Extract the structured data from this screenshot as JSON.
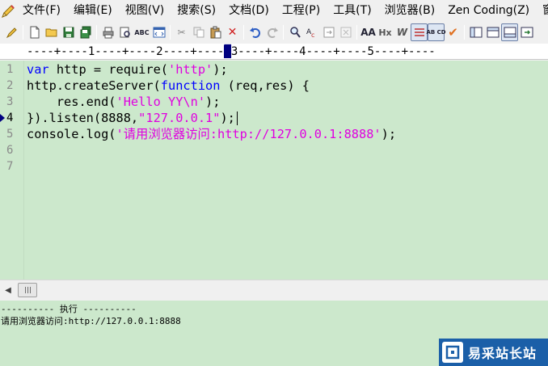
{
  "menubar": {
    "items": [
      "文件(F)",
      "编辑(E)",
      "视图(V)",
      "搜索(S)",
      "文档(D)",
      "工程(P)",
      "工具(T)",
      "浏览器(B)",
      "Zen Coding(Z)",
      "窗"
    ]
  },
  "toolbar": {
    "icons": [
      "pencil-icon",
      "new-file-icon",
      "open-folder-icon",
      "save-icon",
      "save-all-icon",
      "print-icon",
      "print-preview-icon",
      "spellcheck-icon",
      "browser-view-icon",
      "cut-icon",
      "copy-icon",
      "paste-icon",
      "delete-icon",
      "undo-icon",
      "redo-icon",
      "find-icon",
      "replace-icon",
      "goto-icon",
      "clear-icon",
      "font-size-icon",
      "hex-icon",
      "word-wrap-icon",
      "ruler-icon",
      "column-mode-icon",
      "check-icon",
      "panel-icon",
      "panel-2-icon",
      "output-window-icon",
      "more-icon"
    ],
    "labels": {
      "spell": "ABC",
      "font": "AA",
      "hex": "Hx",
      "wrap": "W",
      "column": "AB CD"
    }
  },
  "ruler": {
    "before": "----+----1----+----2----+----",
    "after": "3----+----4----+----5----+----"
  },
  "editor": {
    "line_numbers": [
      "1",
      "2",
      "3",
      "4",
      "5",
      "6",
      "7"
    ],
    "current_line": "4",
    "lines": {
      "l1a": "var",
      "l1b": " http = require(",
      "l1c": "'http'",
      "l1d": ");",
      "l2a": "http.createServer(",
      "l2b": "function",
      "l2c": " (req,res) {",
      "l3a": "    res.end(",
      "l3b": "'Hello YY\\n'",
      "l3c": ");",
      "l4a": "}).listen(8888,",
      "l4b": "\"127.0.0.1\"",
      "l4c": ");",
      "l5a": "console.log(",
      "l5b": "'请用浏览器访问:http://127.0.0.1:8888'",
      "l5c": ");"
    }
  },
  "output": {
    "header": "---------- 执行 ----------",
    "result": "请用浏览器访问:http://127.0.0.1:8888"
  },
  "watermark": {
    "text": "易采站长站"
  }
}
